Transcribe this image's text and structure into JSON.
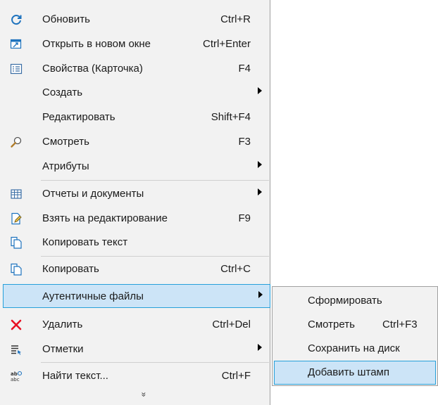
{
  "menu": {
    "items": [
      {
        "label": "Обновить",
        "shortcut": "Ctrl+R",
        "icon": "refresh-icon"
      },
      {
        "label": "Открыть в новом окне",
        "shortcut": "Ctrl+Enter",
        "icon": "open-new-window-icon"
      },
      {
        "label": "Свойства (Карточка)",
        "shortcut": "F4",
        "icon": "properties-card-icon"
      },
      {
        "label": "Создать",
        "shortcut": "",
        "submenu": true
      },
      {
        "label": "Редактировать",
        "shortcut": "Shift+F4"
      },
      {
        "label": "Смотреть",
        "shortcut": "F3",
        "icon": "magnifier-icon"
      },
      {
        "label": "Атрибуты",
        "shortcut": "",
        "submenu": true
      },
      {
        "label": "Отчеты и документы",
        "shortcut": "",
        "submenu": true,
        "icon": "table-report-icon"
      },
      {
        "label": "Взять на редактирование",
        "shortcut": "F9",
        "icon": "edit-document-icon"
      },
      {
        "label": "Копировать текст",
        "shortcut": "",
        "icon": "copy-text-icon"
      },
      {
        "label": "Копировать",
        "shortcut": "Ctrl+C",
        "icon": "copy-icon"
      },
      {
        "label": "Аутентичные файлы",
        "shortcut": "",
        "submenu": true,
        "highlighted": true
      },
      {
        "label": "Удалить",
        "shortcut": "Ctrl+Del",
        "icon": "delete-x-icon"
      },
      {
        "label": "Отметки",
        "shortcut": "",
        "submenu": true,
        "icon": "marks-list-icon"
      },
      {
        "label": "Найти текст...",
        "shortcut": "Ctrl+F",
        "icon": "find-text-icon"
      }
    ],
    "more_glyph": "»"
  },
  "submenu": {
    "items": [
      {
        "label": "Сформировать",
        "shortcut": ""
      },
      {
        "label": "Смотреть",
        "shortcut": "Ctrl+F3"
      },
      {
        "label": "Сохранить на диск",
        "shortcut": ""
      },
      {
        "label": "Добавить штамп",
        "shortcut": "",
        "highlighted": true
      }
    ]
  },
  "colors": {
    "menu_bg": "#f2f2f2",
    "highlight_bg": "#cce4f7",
    "highlight_border": "#26a0da",
    "accent_blue": "#1e73be",
    "delete_red": "#e81123"
  }
}
